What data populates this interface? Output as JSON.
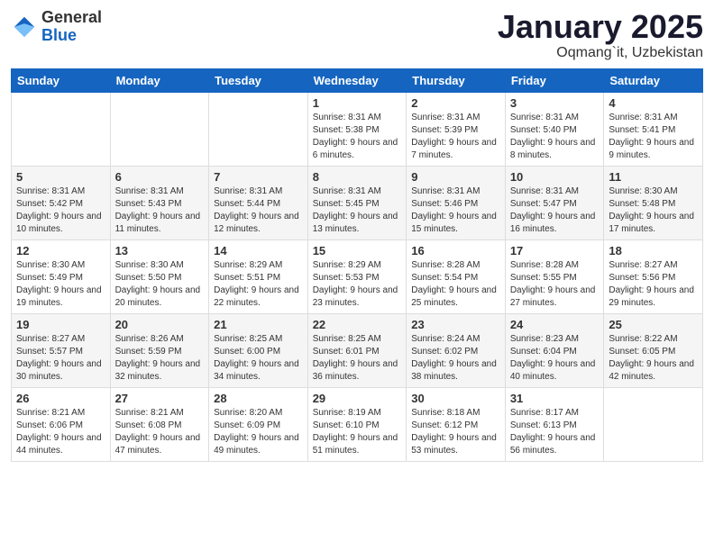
{
  "logo": {
    "general": "General",
    "blue": "Blue"
  },
  "header": {
    "month": "January 2025",
    "location": "Oqmang`it, Uzbekistan"
  },
  "weekdays": [
    "Sunday",
    "Monday",
    "Tuesday",
    "Wednesday",
    "Thursday",
    "Friday",
    "Saturday"
  ],
  "weeks": [
    [
      {
        "day": "",
        "info": ""
      },
      {
        "day": "",
        "info": ""
      },
      {
        "day": "",
        "info": ""
      },
      {
        "day": "1",
        "info": "Sunrise: 8:31 AM\nSunset: 5:38 PM\nDaylight: 9 hours and 6 minutes."
      },
      {
        "day": "2",
        "info": "Sunrise: 8:31 AM\nSunset: 5:39 PM\nDaylight: 9 hours and 7 minutes."
      },
      {
        "day": "3",
        "info": "Sunrise: 8:31 AM\nSunset: 5:40 PM\nDaylight: 9 hours and 8 minutes."
      },
      {
        "day": "4",
        "info": "Sunrise: 8:31 AM\nSunset: 5:41 PM\nDaylight: 9 hours and 9 minutes."
      }
    ],
    [
      {
        "day": "5",
        "info": "Sunrise: 8:31 AM\nSunset: 5:42 PM\nDaylight: 9 hours and 10 minutes."
      },
      {
        "day": "6",
        "info": "Sunrise: 8:31 AM\nSunset: 5:43 PM\nDaylight: 9 hours and 11 minutes."
      },
      {
        "day": "7",
        "info": "Sunrise: 8:31 AM\nSunset: 5:44 PM\nDaylight: 9 hours and 12 minutes."
      },
      {
        "day": "8",
        "info": "Sunrise: 8:31 AM\nSunset: 5:45 PM\nDaylight: 9 hours and 13 minutes."
      },
      {
        "day": "9",
        "info": "Sunrise: 8:31 AM\nSunset: 5:46 PM\nDaylight: 9 hours and 15 minutes."
      },
      {
        "day": "10",
        "info": "Sunrise: 8:31 AM\nSunset: 5:47 PM\nDaylight: 9 hours and 16 minutes."
      },
      {
        "day": "11",
        "info": "Sunrise: 8:30 AM\nSunset: 5:48 PM\nDaylight: 9 hours and 17 minutes."
      }
    ],
    [
      {
        "day": "12",
        "info": "Sunrise: 8:30 AM\nSunset: 5:49 PM\nDaylight: 9 hours and 19 minutes."
      },
      {
        "day": "13",
        "info": "Sunrise: 8:30 AM\nSunset: 5:50 PM\nDaylight: 9 hours and 20 minutes."
      },
      {
        "day": "14",
        "info": "Sunrise: 8:29 AM\nSunset: 5:51 PM\nDaylight: 9 hours and 22 minutes."
      },
      {
        "day": "15",
        "info": "Sunrise: 8:29 AM\nSunset: 5:53 PM\nDaylight: 9 hours and 23 minutes."
      },
      {
        "day": "16",
        "info": "Sunrise: 8:28 AM\nSunset: 5:54 PM\nDaylight: 9 hours and 25 minutes."
      },
      {
        "day": "17",
        "info": "Sunrise: 8:28 AM\nSunset: 5:55 PM\nDaylight: 9 hours and 27 minutes."
      },
      {
        "day": "18",
        "info": "Sunrise: 8:27 AM\nSunset: 5:56 PM\nDaylight: 9 hours and 29 minutes."
      }
    ],
    [
      {
        "day": "19",
        "info": "Sunrise: 8:27 AM\nSunset: 5:57 PM\nDaylight: 9 hours and 30 minutes."
      },
      {
        "day": "20",
        "info": "Sunrise: 8:26 AM\nSunset: 5:59 PM\nDaylight: 9 hours and 32 minutes."
      },
      {
        "day": "21",
        "info": "Sunrise: 8:25 AM\nSunset: 6:00 PM\nDaylight: 9 hours and 34 minutes."
      },
      {
        "day": "22",
        "info": "Sunrise: 8:25 AM\nSunset: 6:01 PM\nDaylight: 9 hours and 36 minutes."
      },
      {
        "day": "23",
        "info": "Sunrise: 8:24 AM\nSunset: 6:02 PM\nDaylight: 9 hours and 38 minutes."
      },
      {
        "day": "24",
        "info": "Sunrise: 8:23 AM\nSunset: 6:04 PM\nDaylight: 9 hours and 40 minutes."
      },
      {
        "day": "25",
        "info": "Sunrise: 8:22 AM\nSunset: 6:05 PM\nDaylight: 9 hours and 42 minutes."
      }
    ],
    [
      {
        "day": "26",
        "info": "Sunrise: 8:21 AM\nSunset: 6:06 PM\nDaylight: 9 hours and 44 minutes."
      },
      {
        "day": "27",
        "info": "Sunrise: 8:21 AM\nSunset: 6:08 PM\nDaylight: 9 hours and 47 minutes."
      },
      {
        "day": "28",
        "info": "Sunrise: 8:20 AM\nSunset: 6:09 PM\nDaylight: 9 hours and 49 minutes."
      },
      {
        "day": "29",
        "info": "Sunrise: 8:19 AM\nSunset: 6:10 PM\nDaylight: 9 hours and 51 minutes."
      },
      {
        "day": "30",
        "info": "Sunrise: 8:18 AM\nSunset: 6:12 PM\nDaylight: 9 hours and 53 minutes."
      },
      {
        "day": "31",
        "info": "Sunrise: 8:17 AM\nSunset: 6:13 PM\nDaylight: 9 hours and 56 minutes."
      },
      {
        "day": "",
        "info": ""
      }
    ]
  ]
}
